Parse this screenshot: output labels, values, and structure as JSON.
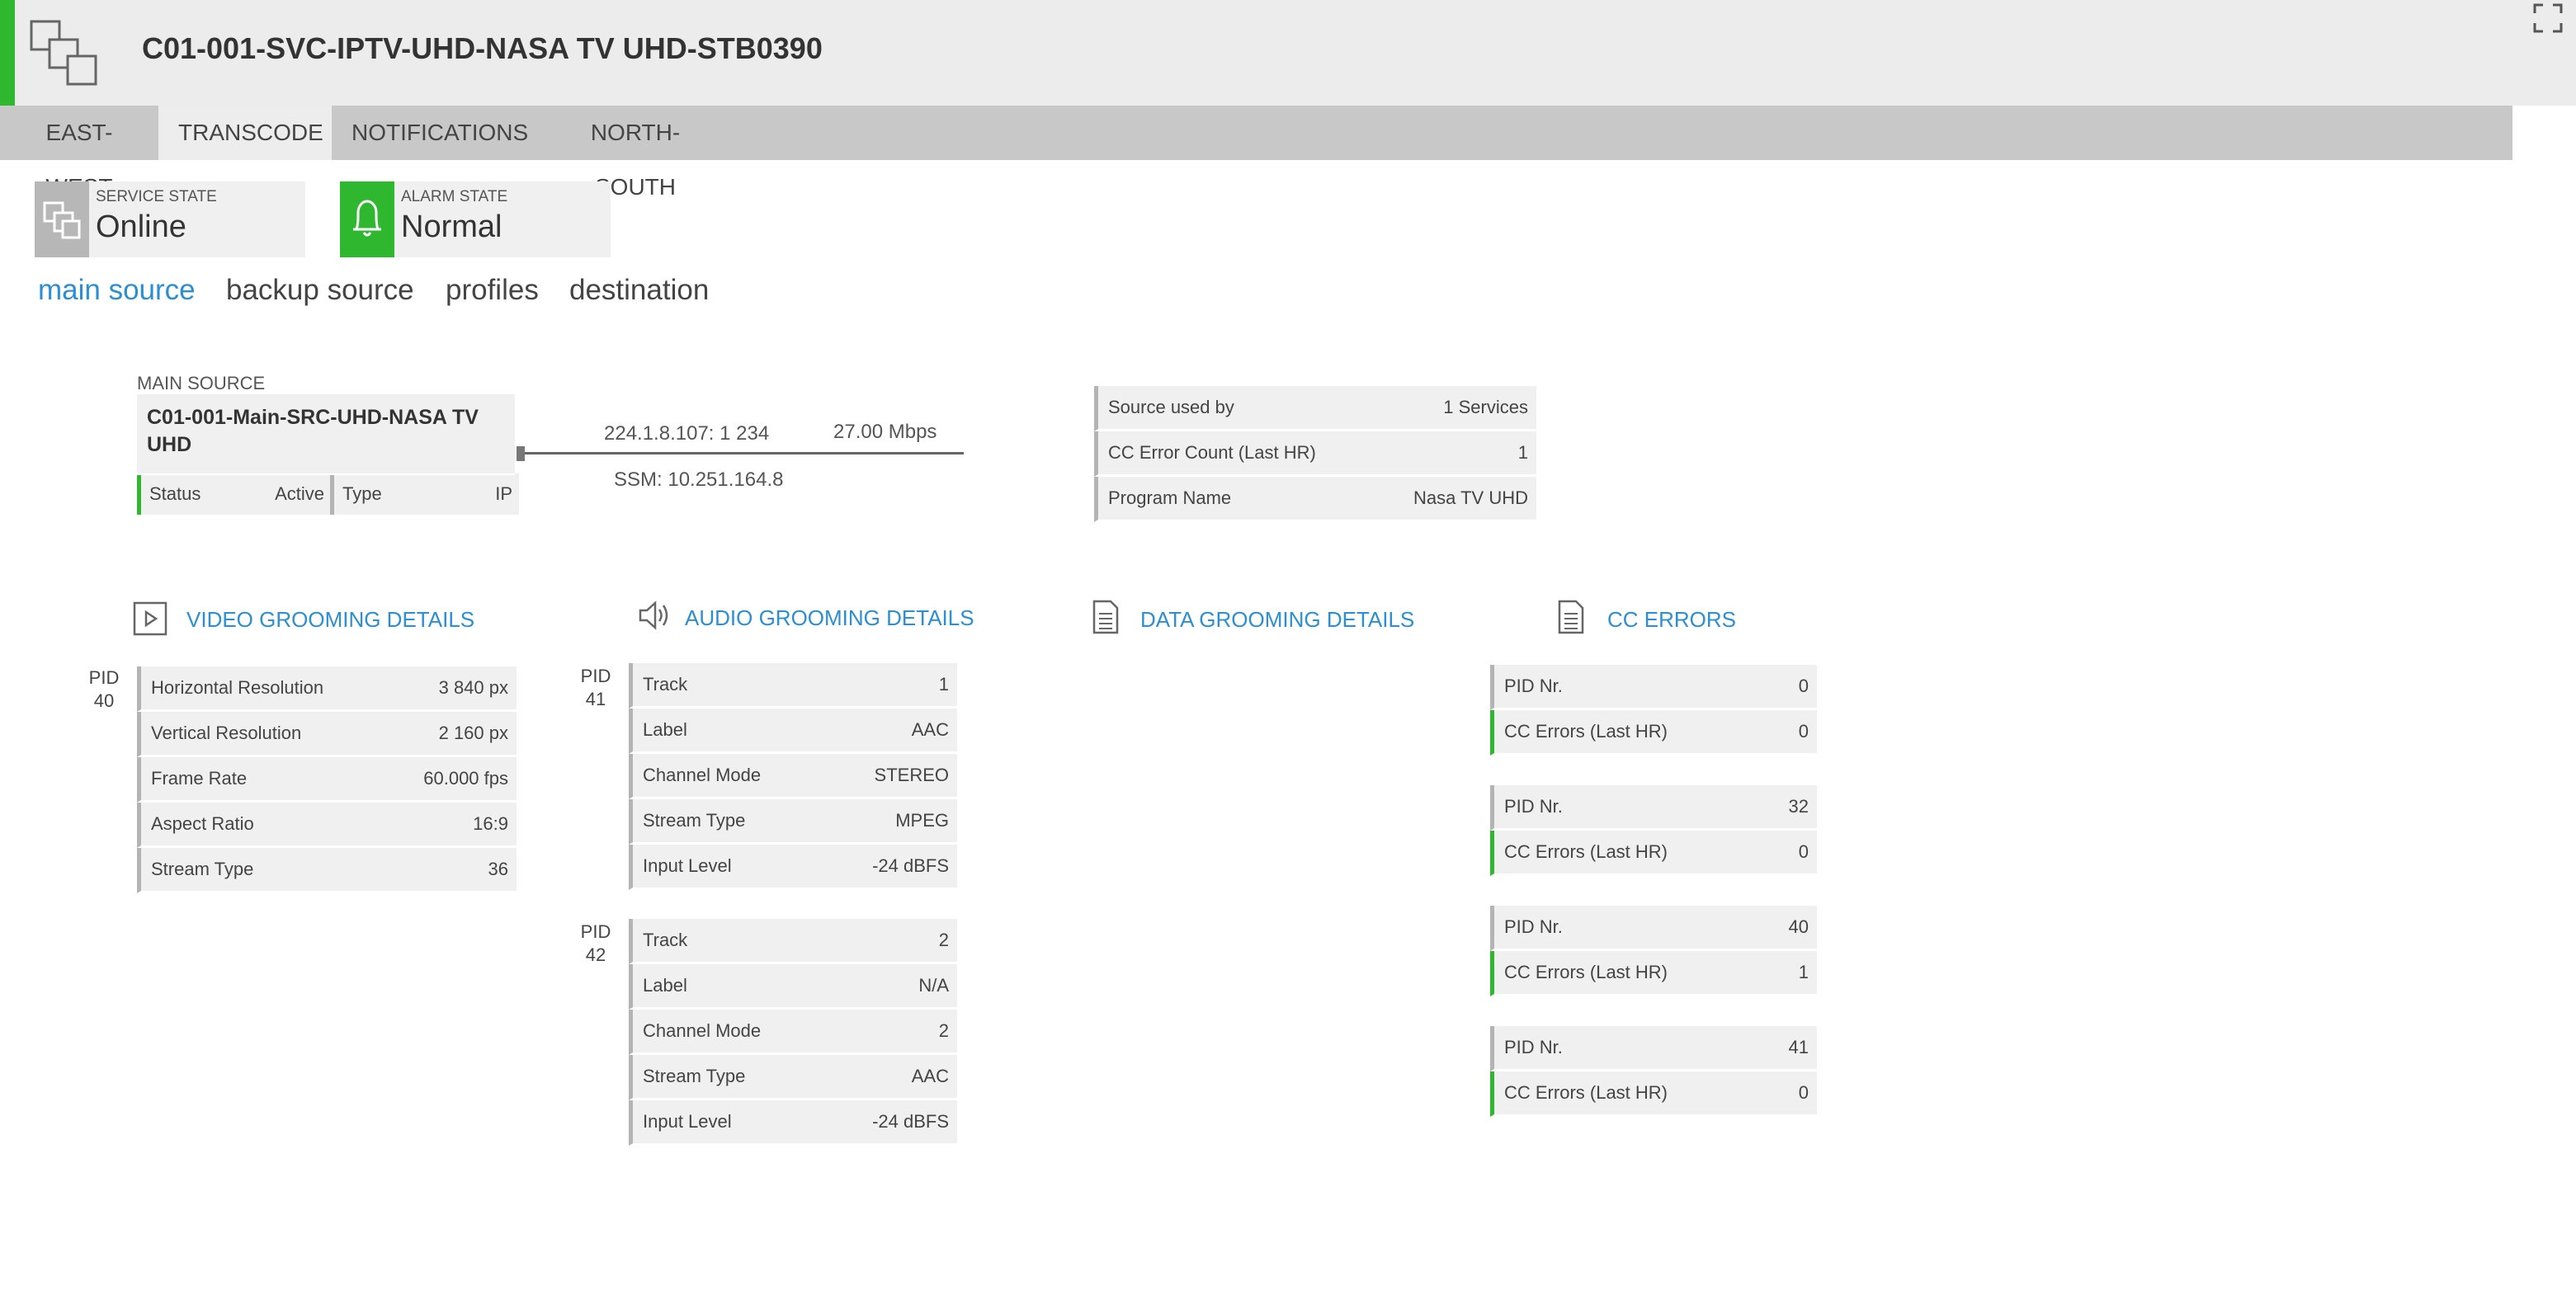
{
  "header": {
    "title": "C01-001-SVC-IPTV-UHD-NASA TV UHD-STB0390",
    "accent_color": "#2fb82f",
    "logo_icon": "service-stack-icon",
    "fullscreen_icon": "fullscreen-icon"
  },
  "tabs": [
    {
      "label": "EAST-WEST"
    },
    {
      "label": "TRANSCODE",
      "active": true
    },
    {
      "label": "NOTIFICATIONS"
    },
    {
      "label": "NORTH-SOUTH"
    }
  ],
  "service_state": {
    "label": "SERVICE STATE",
    "value": "Online"
  },
  "alarm_state": {
    "label": "ALARM STATE",
    "value": "Normal",
    "color": "#2fb82f"
  },
  "subnav": [
    {
      "label": "main source",
      "active": true
    },
    {
      "label": "backup source"
    },
    {
      "label": "profiles"
    },
    {
      "label": "destination"
    }
  ],
  "main_source": {
    "label": "MAIN SOURCE",
    "name": "C01-001-Main-SRC-UHD-NASA TV UHD",
    "status_label": "Status",
    "status_value": "Active",
    "type_label": "Type",
    "type_value": "IP",
    "address": "224.1.8.107: 1 234",
    "bitrate": "27.00 Mbps",
    "ssm": "SSM: 10.251.164.8"
  },
  "source_info": [
    {
      "k": "Source used by",
      "v": "1 Services"
    },
    {
      "k": "CC Error Count (Last HR)",
      "v": "1"
    },
    {
      "k": "Program Name",
      "v": "Nasa TV UHD"
    }
  ],
  "video": {
    "title": "VIDEO GROOMING DETAILS",
    "pid_label": "PID",
    "pid": "40",
    "rows": [
      {
        "k": "Horizontal Resolution",
        "v": "3 840 px"
      },
      {
        "k": "Vertical Resolution",
        "v": "2 160 px"
      },
      {
        "k": "Frame Rate",
        "v": "60.000 fps"
      },
      {
        "k": "Aspect Ratio",
        "v": "16:9"
      },
      {
        "k": "Stream Type",
        "v": "36"
      }
    ]
  },
  "audio": {
    "title": "AUDIO GROOMING DETAILS",
    "pid_label": "PID",
    "tracks": [
      {
        "pid": "41",
        "rows": [
          {
            "k": "Track",
            "v": "1"
          },
          {
            "k": "Label",
            "v": "AAC"
          },
          {
            "k": "Channel Mode",
            "v": "STEREO"
          },
          {
            "k": "Stream Type",
            "v": "MPEG"
          },
          {
            "k": "Input Level",
            "v": "-24 dBFS"
          }
        ]
      },
      {
        "pid": "42",
        "rows": [
          {
            "k": "Track",
            "v": "2"
          },
          {
            "k": "Label",
            "v": "N/A"
          },
          {
            "k": "Channel Mode",
            "v": "2"
          },
          {
            "k": "Stream Type",
            "v": "AAC"
          },
          {
            "k": "Input Level",
            "v": "-24 dBFS"
          }
        ]
      }
    ]
  },
  "data": {
    "title": "DATA GROOMING DETAILS"
  },
  "cc_errors": {
    "title": "CC ERRORS",
    "groups": [
      {
        "pid_k": "PID Nr.",
        "pid_v": "0",
        "err_k": "CC Errors (Last HR)",
        "err_v": "0"
      },
      {
        "pid_k": "PID Nr.",
        "pid_v": "32",
        "err_k": "CC Errors (Last HR)",
        "err_v": "0"
      },
      {
        "pid_k": "PID Nr.",
        "pid_v": "40",
        "err_k": "CC Errors (Last HR)",
        "err_v": "1"
      },
      {
        "pid_k": "PID Nr.",
        "pid_v": "41",
        "err_k": "CC Errors (Last HR)",
        "err_v": "0"
      }
    ]
  }
}
